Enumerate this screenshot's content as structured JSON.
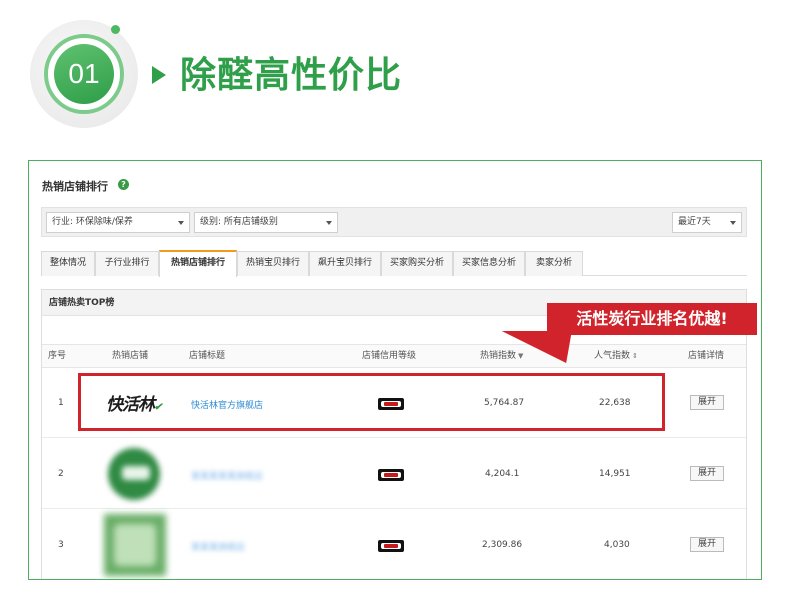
{
  "header": {
    "step_number": "01",
    "title": "除醛高性价比"
  },
  "panel": {
    "title": "热销店铺排行",
    "help_icon": "question-circle-icon",
    "filters": {
      "industry": "行业: 环保除味/保养",
      "level": "级别: 所有店铺级别",
      "period": "最近7天"
    },
    "tabs": [
      "整体情况",
      "子行业排行",
      "热销店铺排行",
      "热销宝贝排行",
      "飙升宝贝排行",
      "买家购买分析",
      "买家信息分析",
      "卖家分析"
    ],
    "active_tab": "热销店铺排行",
    "section_title": "店铺热卖TOP榜",
    "columns": [
      "序号",
      "热销店铺",
      "店铺标题",
      "店铺信用等级",
      "热销指数",
      "人气指数",
      "店铺详情"
    ],
    "rows": [
      {
        "rank": "1",
        "logo_text": "快活林",
        "shop_title": "快活林官方旗舰店",
        "credit_icon": "tmall-credit-icon",
        "hot_index": "5,764.87",
        "popularity": "22,638",
        "detail_button": "展开"
      },
      {
        "rank": "2",
        "logo_text": "",
        "shop_title": "某某某某某旗舰店",
        "credit_icon": "tmall-credit-icon",
        "hot_index": "4,204.1",
        "popularity": "14,951",
        "detail_button": "展开"
      },
      {
        "rank": "3",
        "logo_text": "",
        "shop_title": "某某某旗舰店",
        "credit_icon": "tmall-credit-icon",
        "hot_index": "2,309.86",
        "popularity": "4,030",
        "detail_button": "展开"
      }
    ]
  },
  "annotation": {
    "callout": "活性炭行业排名优越!",
    "highlight_color": "#d1232c"
  },
  "colors": {
    "brand_green": "#2f9f4a",
    "frame_border": "#4cae5e",
    "active_tab_accent": "#f39a1e",
    "link_blue": "#2a8ad4"
  }
}
